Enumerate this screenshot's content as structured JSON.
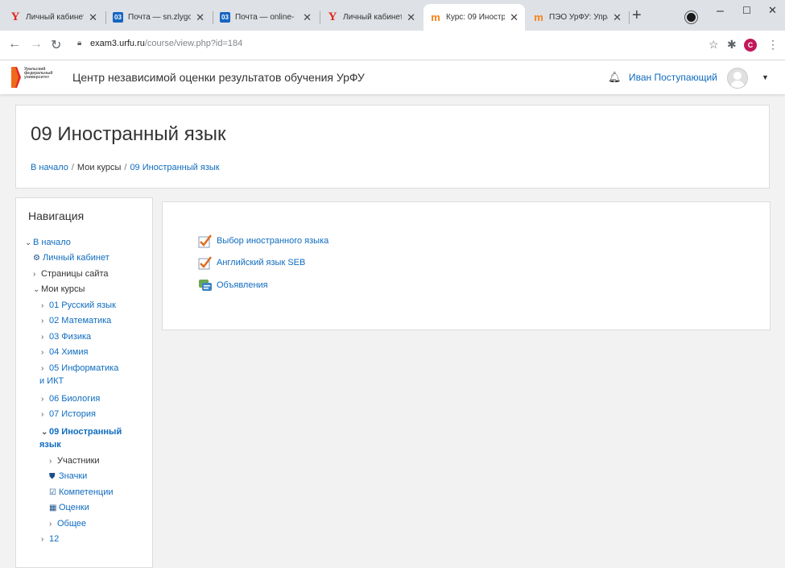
{
  "browser": {
    "tabs": [
      {
        "label": "Личный кабинет",
        "icon": "yandex-y-icon",
        "active": false
      },
      {
        "label": "Почта — sn.zlygo",
        "icon": "mail-icon",
        "active": false
      },
      {
        "label": "Почта — online-",
        "icon": "mail-icon",
        "active": false
      },
      {
        "label": "Личный кабинет",
        "icon": "yandex-y-icon",
        "active": false
      },
      {
        "label": "Курс: 09 Иностра",
        "icon": "moodle-icon",
        "active": true
      },
      {
        "label": "ПЭО УрФУ: Управ",
        "icon": "moodle-icon",
        "active": false
      }
    ],
    "tab_close": "✕",
    "new_tab": "+",
    "url_host": "exam3.urfu.ru",
    "url_path": "/course/view.php?id=184",
    "profile_letter": "C"
  },
  "site": {
    "logo_lines": [
      "Уральский",
      "федеральный",
      "университет"
    ],
    "name": "Центр независимой оценки результатов обучения УрФУ",
    "user_name": "Иван Поступающий"
  },
  "page": {
    "title": "09 Иностранный язык",
    "breadcrumbs": [
      "В начало",
      "Мои курсы",
      "09 Иностранный язык"
    ]
  },
  "navigation": {
    "heading": "Навигация",
    "items": [
      {
        "label": "В начало",
        "chev": "⌄"
      },
      {
        "label": "Личный кабинет",
        "icon": "dashboard-icon"
      },
      {
        "label": "Страницы сайта",
        "chev": "›"
      },
      {
        "label": "Мои курсы",
        "chev": "⌄"
      },
      {
        "label": "01 Русский язык",
        "chev": "›"
      },
      {
        "label": "02 Математика",
        "chev": "›"
      },
      {
        "label": "03 Физика",
        "chev": "›"
      },
      {
        "label": "04 Химия",
        "chev": "›"
      },
      {
        "label": "05 Информатика",
        "chev": "›"
      },
      {
        "label": "и ИКТ"
      },
      {
        "label": "06 Биология",
        "chev": "›"
      },
      {
        "label": "07 История",
        "chev": "›"
      },
      {
        "label": "09 Иностранный",
        "chev": "⌄"
      },
      {
        "label": "язык"
      },
      {
        "label": "Участники",
        "chev": "›"
      },
      {
        "label": "Значки",
        "icon": "shield-icon"
      },
      {
        "label": "Компетенции",
        "icon": "checkbox-icon"
      },
      {
        "label": "Оценки",
        "icon": "table-icon"
      },
      {
        "label": "Общее",
        "chev": "›"
      },
      {
        "label": "12",
        "chev": "›"
      }
    ]
  },
  "activities": [
    {
      "label": "Выбор иностранного языка",
      "icon": "quiz-check-icon"
    },
    {
      "label": "Английский язык SEB",
      "icon": "quiz-check-icon"
    },
    {
      "label": "Объявления",
      "icon": "forum-icon"
    }
  ]
}
